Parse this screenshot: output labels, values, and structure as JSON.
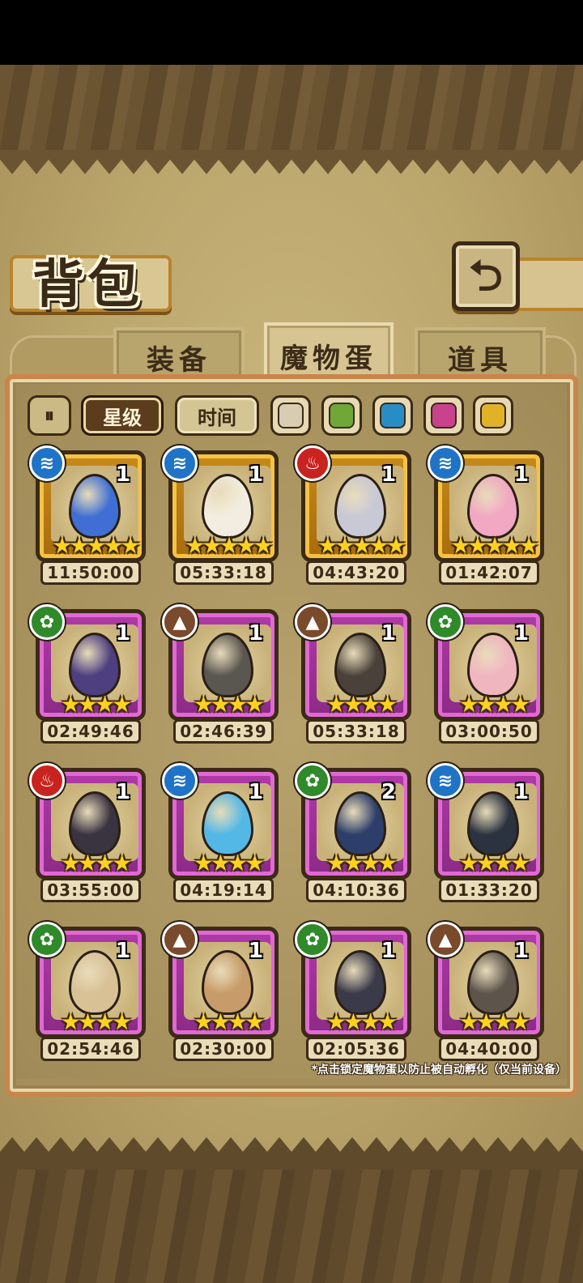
{
  "title": "背包",
  "back_icon": "return-arrow-icon",
  "tabs": [
    {
      "label": "装备",
      "active": false
    },
    {
      "label": "魔物蛋",
      "active": true
    },
    {
      "label": "道具",
      "active": false
    }
  ],
  "filters": {
    "sort_icon": "sort-toggle-icon",
    "star_label": "星级",
    "time_label": "时间",
    "swatches": [
      "#d8cdb0",
      "#6fa836",
      "#2a8cc4",
      "#c8428e",
      "#e0b227"
    ]
  },
  "eggs": [
    {
      "element": "water",
      "count": "1",
      "stars": "★★★★★",
      "timer": "11:50:00",
      "rarity": "gold",
      "color": "#3f6fd4"
    },
    {
      "element": "water",
      "count": "1",
      "stars": "★★★★★",
      "timer": "05:33:18",
      "rarity": "gold",
      "color": "#f2ede0"
    },
    {
      "element": "fire",
      "count": "1",
      "stars": "★★★★★",
      "timer": "04:43:20",
      "rarity": "gold",
      "color": "#c9c9d6"
    },
    {
      "element": "water",
      "count": "1",
      "stars": "★★★★★",
      "timer": "01:42:07",
      "rarity": "gold",
      "color": "#f2a7c3"
    },
    {
      "element": "grass",
      "count": "1",
      "stars": "★★★★",
      "timer": "02:49:46",
      "rarity": "purple",
      "color": "#4d3f80"
    },
    {
      "element": "earth",
      "count": "1",
      "stars": "★★★★",
      "timer": "02:46:39",
      "rarity": "purple",
      "color": "#5a5650"
    },
    {
      "element": "earth",
      "count": "1",
      "stars": "★★★★",
      "timer": "05:33:18",
      "rarity": "purple",
      "color": "#4a423a"
    },
    {
      "element": "grass",
      "count": "1",
      "stars": "★★★★",
      "timer": "03:00:50",
      "rarity": "purple",
      "color": "#f0b6c0"
    },
    {
      "element": "fire",
      "count": "1",
      "stars": "★★★★",
      "timer": "03:55:00",
      "rarity": "purple",
      "color": "#3a3340"
    },
    {
      "element": "water",
      "count": "1",
      "stars": "★★★★",
      "timer": "04:19:14",
      "rarity": "purple",
      "color": "#54b8e6"
    },
    {
      "element": "grass",
      "count": "2",
      "stars": "★★★★",
      "timer": "04:10:36",
      "rarity": "purple",
      "color": "#2d3e6a"
    },
    {
      "element": "water",
      "count": "1",
      "stars": "★★★★",
      "timer": "01:33:20",
      "rarity": "purple",
      "color": "#2b3340"
    },
    {
      "element": "grass",
      "count": "1",
      "stars": "★★★★",
      "timer": "02:54:46",
      "rarity": "purple",
      "color": "#d9c196"
    },
    {
      "element": "earth",
      "count": "1",
      "stars": "★★★★",
      "timer": "02:30:00",
      "rarity": "purple",
      "color": "#c89c6a"
    },
    {
      "element": "grass",
      "count": "1",
      "stars": "★★★★",
      "timer": "02:05:36",
      "rarity": "purple",
      "color": "#3b3a4a"
    },
    {
      "element": "earth",
      "count": "1",
      "stars": "★★★★",
      "timer": "04:40:00",
      "rarity": "purple",
      "color": "#5d544c"
    }
  ],
  "element_icons": {
    "water": "water-element-icon",
    "fire": "fire-element-icon",
    "grass": "leaf-element-icon",
    "earth": "mountain-element-icon"
  },
  "footnote": "*点击锁定魔物蛋以防止被自动孵化（仅当前设备）"
}
